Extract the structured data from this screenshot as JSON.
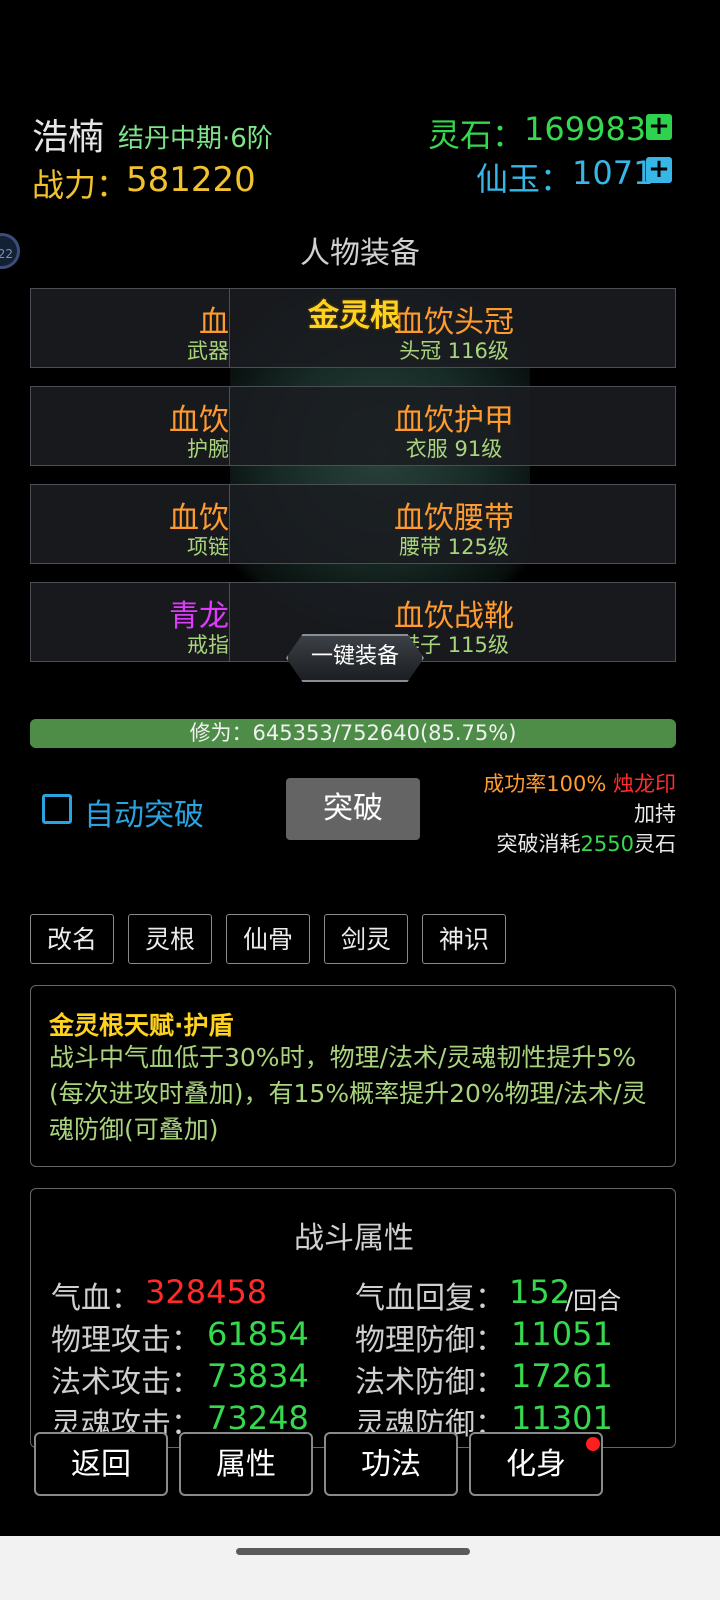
{
  "header": {
    "name": "浩楠",
    "realm": "结丹中期·6阶",
    "power_label": "战力：",
    "power_value": "581220",
    "stone_label": "灵石：",
    "stone_value": "169983",
    "jade_label": "仙玉：",
    "jade_value": "1071",
    "plus": "+",
    "edge_badge": "22"
  },
  "equipment": {
    "title": "人物装备",
    "spirit_root": "金灵根",
    "slots": [
      {
        "left_title": "血",
        "left_sub": "武器",
        "left_color": "#ff9b2e",
        "right_title": "血饮头冠",
        "right_sub": "头冠 116级"
      },
      {
        "left_title": "血饮",
        "left_sub": "护腕",
        "left_color": "#ff9b2e",
        "right_title": "血饮护甲",
        "right_sub": "衣服 91级"
      },
      {
        "left_title": "血饮",
        "left_sub": "项链",
        "left_color": "#ff9b2e",
        "right_title": "血饮腰带",
        "right_sub": "腰带 125级"
      },
      {
        "left_title": "青龙",
        "left_sub": "戒指",
        "left_color": "#e03aff",
        "right_title": "血饮战靴",
        "right_sub": "鞋子 115级"
      }
    ],
    "equip_all": "一键装备"
  },
  "cultivation": {
    "text": "修为：645353/752640(85.75%)",
    "progress": 0.8575
  },
  "breakthrough": {
    "auto_label": "自动突破",
    "button": "突破",
    "rate": "成功率100%",
    "seal": "烛龙印",
    "boost": "加持",
    "cost_prefix": "突破消耗",
    "cost_value": "2550",
    "cost_suffix": "灵石"
  },
  "tabs": [
    "改名",
    "灵根",
    "仙骨",
    "剑灵",
    "神识"
  ],
  "talent": {
    "title": "金灵根天赋·护盾",
    "desc": "战斗中气血低于30%时，物理/法术/灵魂韧性提升5%(每次进攻时叠加)，有15%概率提升20%物理/法术/灵魂防御(可叠加)"
  },
  "stats": {
    "title": "战斗属性",
    "rows": [
      {
        "l1": "气血：",
        "v1": "328458",
        "l2": "气血回复：",
        "v2": "152",
        "u2": "/回合"
      },
      {
        "l1": "物理攻击：",
        "v1": "61854",
        "l2": "物理防御：",
        "v2": "11051"
      },
      {
        "l1": "法术攻击：",
        "v1": "73834",
        "l2": "法术防御：",
        "v2": "17261"
      },
      {
        "l1": "灵魂攻击：",
        "v1": "73248",
        "l2": "灵魂防御：",
        "v2": "11301"
      }
    ]
  },
  "bottom": {
    "back": "返回",
    "attributes": "属性",
    "skills": "功法",
    "avatar": "化身"
  },
  "colors": {
    "stone": "#36d94d",
    "jade": "#37b7e8",
    "gold": "#ffd21f",
    "orange": "#ff9b2e",
    "green_bar": "#4e8d47"
  }
}
